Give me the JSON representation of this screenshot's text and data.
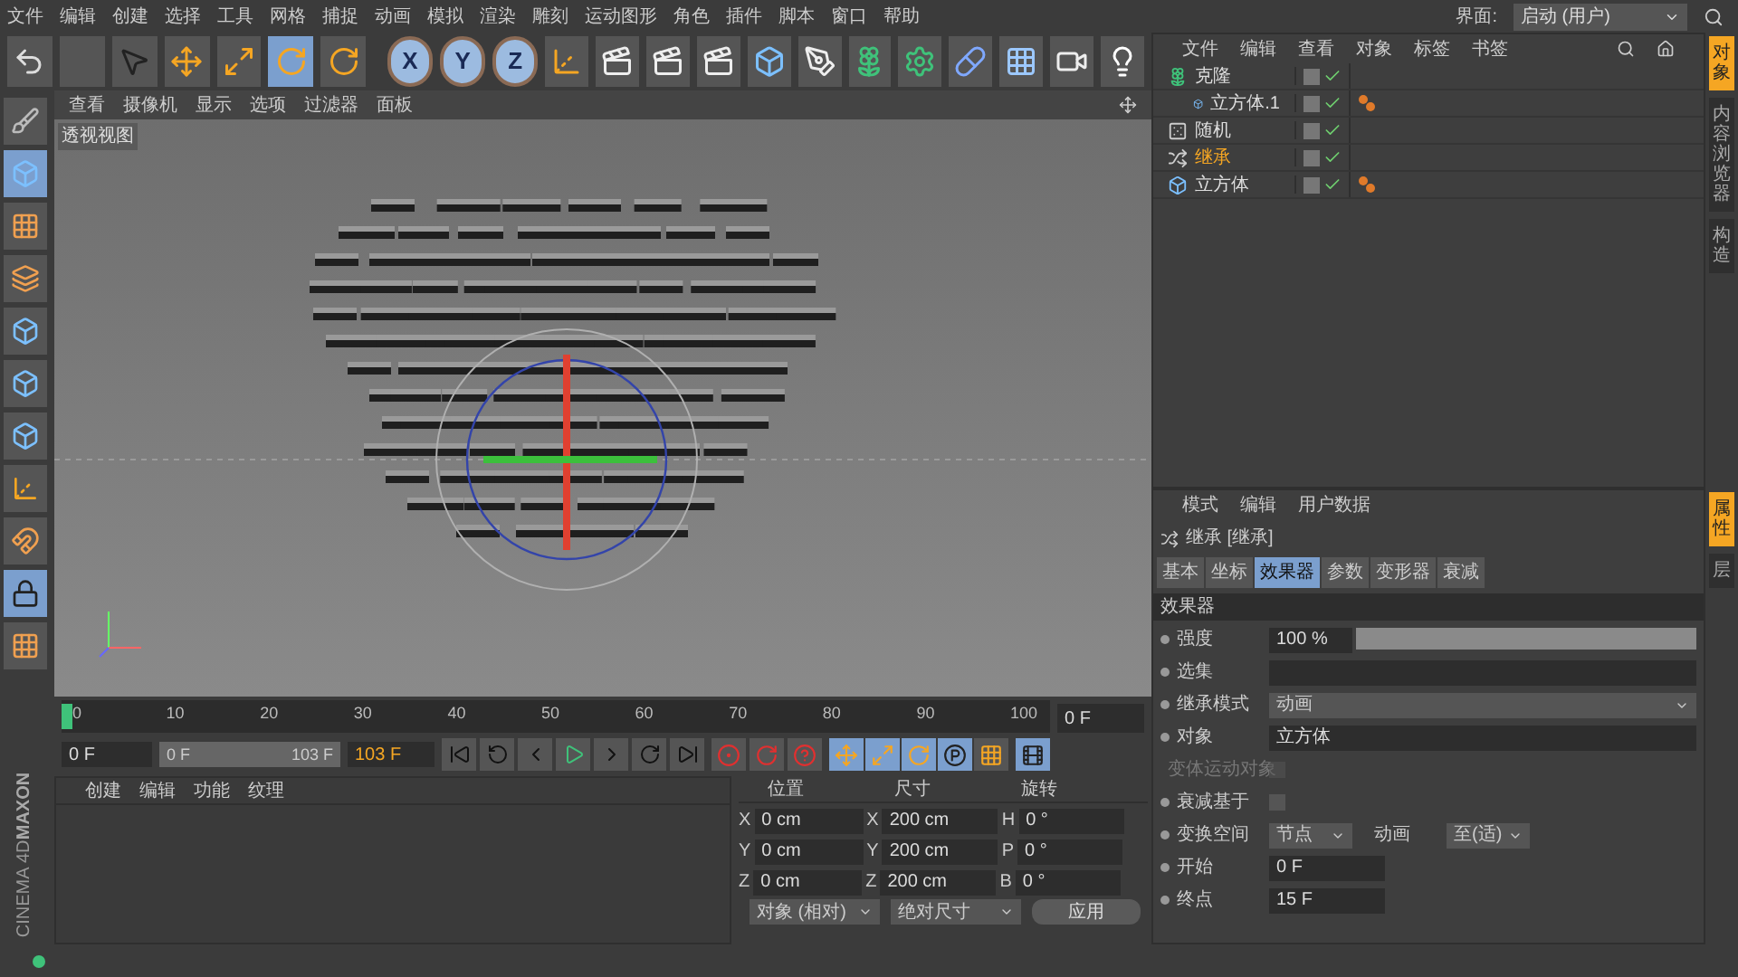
{
  "menu_bar": {
    "items": [
      "文件",
      "编辑",
      "创建",
      "选择",
      "工具",
      "网格",
      "捕捉",
      "动画",
      "模拟",
      "渲染",
      "雕刻",
      "运动图形",
      "角色",
      "插件",
      "脚本",
      "窗口",
      "帮助"
    ],
    "layout_label": "界面:",
    "layout_value": "启动 (用户)"
  },
  "toolbar": {
    "tools": [
      {
        "kind": "undo",
        "selected": false,
        "disabled": false
      },
      {
        "kind": "redo",
        "selected": false,
        "disabled": true
      },
      {
        "kind": "select",
        "selected": false,
        "disabled": false
      },
      {
        "kind": "move",
        "selected": false,
        "disabled": false
      },
      {
        "kind": "scale",
        "selected": false,
        "disabled": false
      },
      {
        "kind": "rotate",
        "selected": true,
        "disabled": false
      },
      {
        "kind": "rotate",
        "selected": false,
        "disabled": false
      }
    ],
    "axes": [
      {
        "label": "X",
        "selected": true
      },
      {
        "label": "Y",
        "selected": true
      },
      {
        "label": "Z",
        "selected": true
      }
    ],
    "objects": [
      {
        "kind": "coord"
      },
      {
        "kind": "clapper"
      },
      {
        "kind": "clapper"
      },
      {
        "kind": "clapper"
      },
      {
        "kind": "cube"
      },
      {
        "kind": "pen"
      },
      {
        "kind": "cloner"
      },
      {
        "kind": "gear"
      },
      {
        "kind": "capsule"
      },
      {
        "kind": "floor"
      },
      {
        "kind": "camera"
      },
      {
        "kind": "light"
      }
    ]
  },
  "left_tools": [
    {
      "kind": "sculpt",
      "selected": false
    },
    {
      "kind": "cube",
      "selected": true
    },
    {
      "kind": "checker",
      "selected": false
    },
    {
      "kind": "layers",
      "selected": false
    },
    {
      "kind": "cube",
      "selected": false
    },
    {
      "kind": "cube",
      "selected": false
    },
    {
      "kind": "cube",
      "selected": false
    },
    {
      "kind": "coord",
      "selected": false
    },
    {
      "kind": "magnet",
      "selected": false
    },
    {
      "kind": "lock",
      "selected": true
    },
    {
      "kind": "checker",
      "selected": false
    }
  ],
  "viewport": {
    "menu": [
      "查看",
      "摄像机",
      "显示",
      "选项",
      "过滤器",
      "面板"
    ],
    "label": "透视视图"
  },
  "timeline": {
    "ticks": [
      "0",
      "10",
      "20",
      "30",
      "40",
      "50",
      "60",
      "70",
      "80",
      "90",
      "100"
    ],
    "level": 0,
    "current": "0 F"
  },
  "transport": {
    "start": "0 F",
    "range_start": "0 F",
    "range_end": "103 F",
    "level": 1,
    "end": "103 F",
    "key_filters": [
      {
        "kind": "position",
        "selected": true
      },
      {
        "kind": "scale",
        "selected": true
      },
      {
        "kind": "rotate",
        "selected": true
      },
      {
        "kind": "param",
        "selected": true
      },
      {
        "kind": "points",
        "selected": false
      }
    ]
  },
  "logo": {
    "brand": "MAXON",
    "product": "CINEMA 4D"
  },
  "material_manager": {
    "menu": [
      "创建",
      "编辑",
      "功能",
      "纹理"
    ]
  },
  "coordinates": {
    "headers": [
      "位置",
      "尺寸",
      "旋转"
    ],
    "rows": [
      {
        "pos_axis": "X",
        "pos": "0 cm",
        "size_axis": "X",
        "size": "200 cm",
        "rot_axis": "H",
        "rot": "0 °"
      },
      {
        "pos_axis": "Y",
        "pos": "0 cm",
        "size_axis": "Y",
        "size": "200 cm",
        "rot_axis": "P",
        "rot": "0 °"
      },
      {
        "pos_axis": "Z",
        "pos": "0 cm",
        "size_axis": "Z",
        "size": "200 cm",
        "rot_axis": "B",
        "rot": "0 °"
      }
    ],
    "dropdowns": [
      "对象 (相对)",
      "绝对尺寸"
    ],
    "apply": "应用"
  },
  "object_manager": {
    "menu": [
      "文件",
      "编辑",
      "查看",
      "对象",
      "标签",
      "书签"
    ],
    "tree": [
      {
        "name": "克隆",
        "kind": "cloner",
        "selected": false,
        "tag": false,
        "children": [
          {
            "name": "立方体.1",
            "kind": "cube",
            "selected": false,
            "tag": true
          }
        ]
      },
      {
        "name": "随机",
        "kind": "random",
        "selected": false,
        "tag": false
      },
      {
        "name": "继承",
        "kind": "inherit",
        "selected": true,
        "tag": false
      },
      {
        "name": "立方体",
        "kind": "cube",
        "selected": false,
        "tag": true
      }
    ]
  },
  "side_tabs_top": [
    {
      "label": "对象",
      "selected": true
    },
    {
      "label": "内容浏览器",
      "selected": false
    },
    {
      "label": "构造",
      "selected": false
    }
  ],
  "side_tabs_bottom": [
    {
      "label": "属性",
      "selected": true
    },
    {
      "label": "层",
      "selected": false
    }
  ],
  "attributes": {
    "menu": [
      "模式",
      "编辑",
      "用户数据"
    ],
    "title": "继承 [继承]",
    "tabs": [
      {
        "label": "基本",
        "selected": false
      },
      {
        "label": "坐标",
        "selected": false
      },
      {
        "label": "效果器",
        "selected": true
      },
      {
        "label": "参数",
        "selected": false
      },
      {
        "label": "变形器",
        "selected": false
      },
      {
        "label": "衰减",
        "selected": false
      }
    ],
    "section": "效果器",
    "rows": [
      {
        "kind": "slider",
        "label": "强度",
        "value": "100 %",
        "level": 1
      },
      {
        "kind": "field",
        "label": "选集"
      },
      {
        "kind": "dropdown",
        "label": "继承模式",
        "value": "动画"
      },
      {
        "kind": "link",
        "label": "对象",
        "value": "立方体"
      },
      {
        "kind": "checkbox",
        "label": "变体运动对象",
        "checked": false,
        "disabled": true
      },
      {
        "kind": "checkbox",
        "label": "衰减基于",
        "checked": false,
        "disabled": false
      },
      {
        "kind": "pair",
        "label": "变换空间",
        "value": "节点",
        "label2": "动画",
        "value2": "至(适)"
      },
      {
        "kind": "field",
        "label": "开始",
        "value": "0 F"
      },
      {
        "kind": "field",
        "label": "终点",
        "value": "15 F"
      }
    ]
  }
}
